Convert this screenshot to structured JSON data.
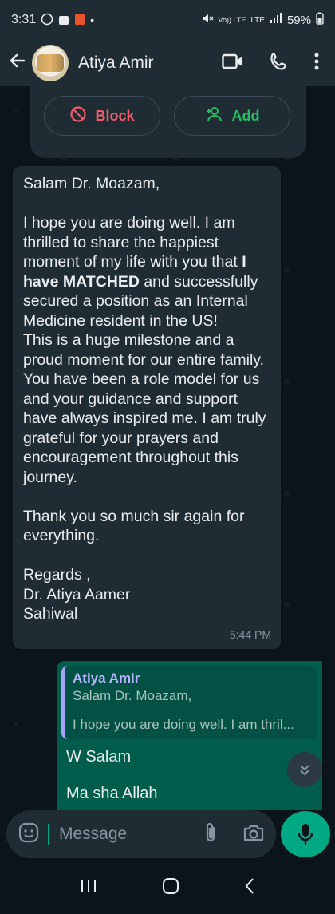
{
  "status_bar": {
    "time": "3:31",
    "volte": "Vo)) LTE",
    "network": "LTE",
    "battery": "59%"
  },
  "header": {
    "contact_name": "Atiya Amir",
    "icons": [
      "arrow-back-icon",
      "video-call-icon",
      "phone-icon",
      "more-vert-icon"
    ]
  },
  "unknown_contact_actions": {
    "block_label": "Block",
    "add_label": "Add",
    "block_color": "#f15c6d",
    "add_color": "#21c063"
  },
  "incoming_message": {
    "greeting": "Salam Dr. Moazam,",
    "p1_a": "I hope you are doing well. I am thrilled to share the happiest moment of my life with you that ",
    "p1_bold": "I have MATCHED",
    "p1_b": " and successfully secured a position as an Internal Medicine resident in the US!",
    "p2": "This is a huge milestone and a proud moment for our entire family. You have been a role model for us and your guidance and support have always inspired me. I am truly grateful for your prayers and encouragement throughout this journey.",
    "p3": "Thank you so much sir again for everything.",
    "sign1": "Regards ,",
    "sign2": "Dr. Atiya Aamer",
    "sign3": "Sahiwal",
    "time": "5:44 PM"
  },
  "outgoing_message": {
    "quote_name": "Atiya Amir",
    "quote_line1": "Salam Dr. Moazam,",
    "quote_line2": "I hope you are doing well. I am thril...",
    "reply_line1": "W Salam",
    "reply_line2": "Ma sha Allah"
  },
  "composer": {
    "placeholder": "Message",
    "icons": [
      "sticker-icon",
      "attach-icon",
      "camera-icon",
      "mic-icon"
    ]
  },
  "colors": {
    "accent": "#00a884",
    "incoming_bubble": "#202c33",
    "outgoing_bubble": "#005c4b",
    "background": "#0b141a"
  }
}
